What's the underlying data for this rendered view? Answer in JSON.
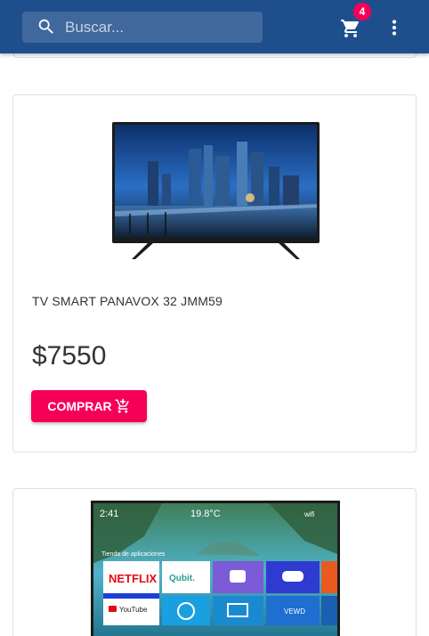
{
  "header": {
    "search": {
      "placeholder": "Buscar..."
    },
    "cart": {
      "icon": "shopping-cart-icon",
      "count": "4"
    },
    "menu": {
      "icon": "more-vert-icon"
    }
  },
  "colors": {
    "appbar": "#1f4e8c",
    "accent": "#f50057"
  },
  "products": [
    {
      "title": "TV SMART PANAVOX 32 JMM59",
      "price": "$7550",
      "buy_label": "COMPRAR",
      "buy_icon": "add-shopping-cart-icon"
    },
    {
      "screen": {
        "time": "2:41",
        "temperature": "19.8°C",
        "network": "wifi",
        "section_label": "Tienda de aplicaciones",
        "tiles": [
          "NETFLIX",
          "Qubit.",
          "YouTube",
          "VEWD"
        ]
      }
    }
  ]
}
